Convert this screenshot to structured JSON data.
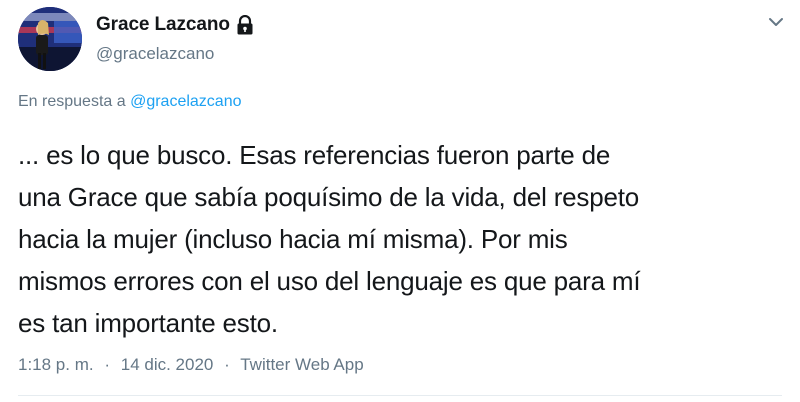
{
  "author": {
    "display_name": "Grace Lazcano",
    "handle": "@gracelazcano",
    "protected_icon": "lock-icon"
  },
  "header": {
    "menu_icon": "chevron-down-icon"
  },
  "reply": {
    "prefix": "En respuesta a",
    "mention": "@gracelazcano"
  },
  "tweet": {
    "lines": [
      "... es lo que busco. Esas referencias fueron parte de",
      "una Grace que sabía poquísimo de la vida, del respeto",
      "hacia la mujer (incluso hacia mí misma). Por mis",
      "mismos errores con el uso del lenguaje es que para mí",
      "es tan importante esto."
    ]
  },
  "meta": {
    "time": "1:18 p. m.",
    "separator": "·",
    "date": "14 dic. 2020",
    "source": "Twitter Web App"
  },
  "colors": {
    "text": "#14171a",
    "secondary": "#657786",
    "link": "#1da1f2",
    "divider": "#e6ecf0"
  }
}
